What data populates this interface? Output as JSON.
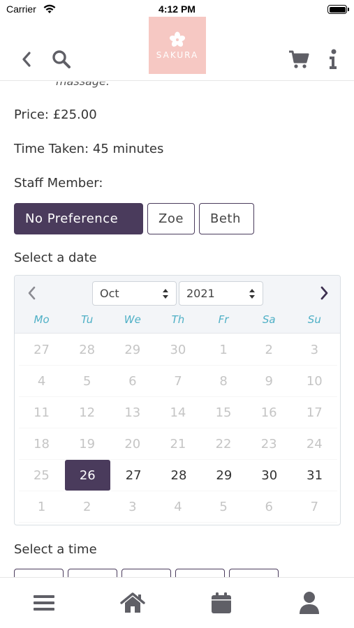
{
  "status_bar": {
    "carrier": "Carrier",
    "time": "4:12 PM"
  },
  "header": {
    "logo_text": "SAKURA",
    "icons": {
      "back": "back-chevron-icon",
      "search": "search-icon",
      "cart": "cart-icon",
      "info": "info-icon"
    }
  },
  "service": {
    "description_fragment": "massage.",
    "price": "Price: £25.00",
    "time_taken": "Time Taken: 45 minutes",
    "staff_label": "Staff Member:",
    "staff_options": [
      "No Preference",
      "Zoe",
      "Beth"
    ],
    "selected_staff": "No Preference"
  },
  "calendar": {
    "label": "Select a date",
    "month": "Oct",
    "year": "2021",
    "weekdays": [
      "Mo",
      "Tu",
      "We",
      "Th",
      "Fr",
      "Sa",
      "Su"
    ],
    "weeks": [
      [
        "27",
        "28",
        "29",
        "30",
        "1",
        "2",
        "3"
      ],
      [
        "4",
        "5",
        "6",
        "7",
        "8",
        "9",
        "10"
      ],
      [
        "11",
        "12",
        "13",
        "14",
        "15",
        "16",
        "17"
      ],
      [
        "18",
        "19",
        "20",
        "21",
        "22",
        "23",
        "24"
      ],
      [
        "25",
        "26",
        "27",
        "28",
        "29",
        "30",
        "31"
      ],
      [
        "1",
        "2",
        "3",
        "4",
        "5",
        "6",
        "7"
      ]
    ],
    "selected_day": "26",
    "available_days": [
      "26",
      "27",
      "28",
      "29",
      "30",
      "31"
    ]
  },
  "time": {
    "label": "Select a time",
    "slot_count": 5
  },
  "tab_bar": {
    "icons": [
      "menu-icon",
      "home-icon",
      "calendar-icon",
      "profile-icon"
    ]
  },
  "colors": {
    "accent": "#4a3b5c",
    "weekday": "#4fb0c6",
    "logo_bg": "#f6c8c3",
    "icon": "#5f5f66"
  }
}
